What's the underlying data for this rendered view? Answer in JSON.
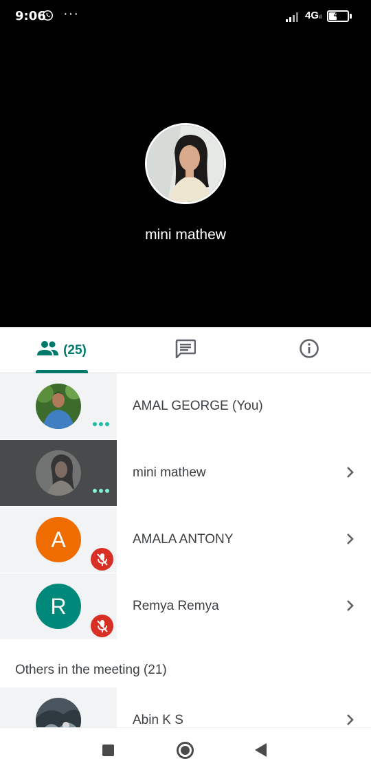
{
  "status_bar": {
    "time": "9:06",
    "network": "4G",
    "network_sub": "ıl",
    "battery": "44",
    "battery_level": 0.44
  },
  "stage": {
    "speaker_name": "mini mathew"
  },
  "tabs": {
    "people_count": "(25)",
    "people_icon": "people-icon",
    "chat_icon": "chat-icon",
    "info_icon": "info-icon"
  },
  "participants": [
    {
      "name": "AMAL GEORGE (You)",
      "avatar": "photo",
      "status": "speaking-dots"
    },
    {
      "name": "mini mathew",
      "avatar": "photo",
      "status": "speaking-dots"
    },
    {
      "name": "AMALA ANTONY",
      "avatar_letter": "A",
      "avatar_color": "#ef6c00",
      "status": "muted"
    },
    {
      "name": "Remya Remya",
      "avatar_letter": "R",
      "avatar_color": "#00897b",
      "status": "muted"
    }
  ],
  "others_section": {
    "title": "Others in the meeting (21)",
    "first": {
      "name": "Abin K S"
    }
  },
  "colors": {
    "accent": "#00796b",
    "muted_badge": "#d93025"
  }
}
